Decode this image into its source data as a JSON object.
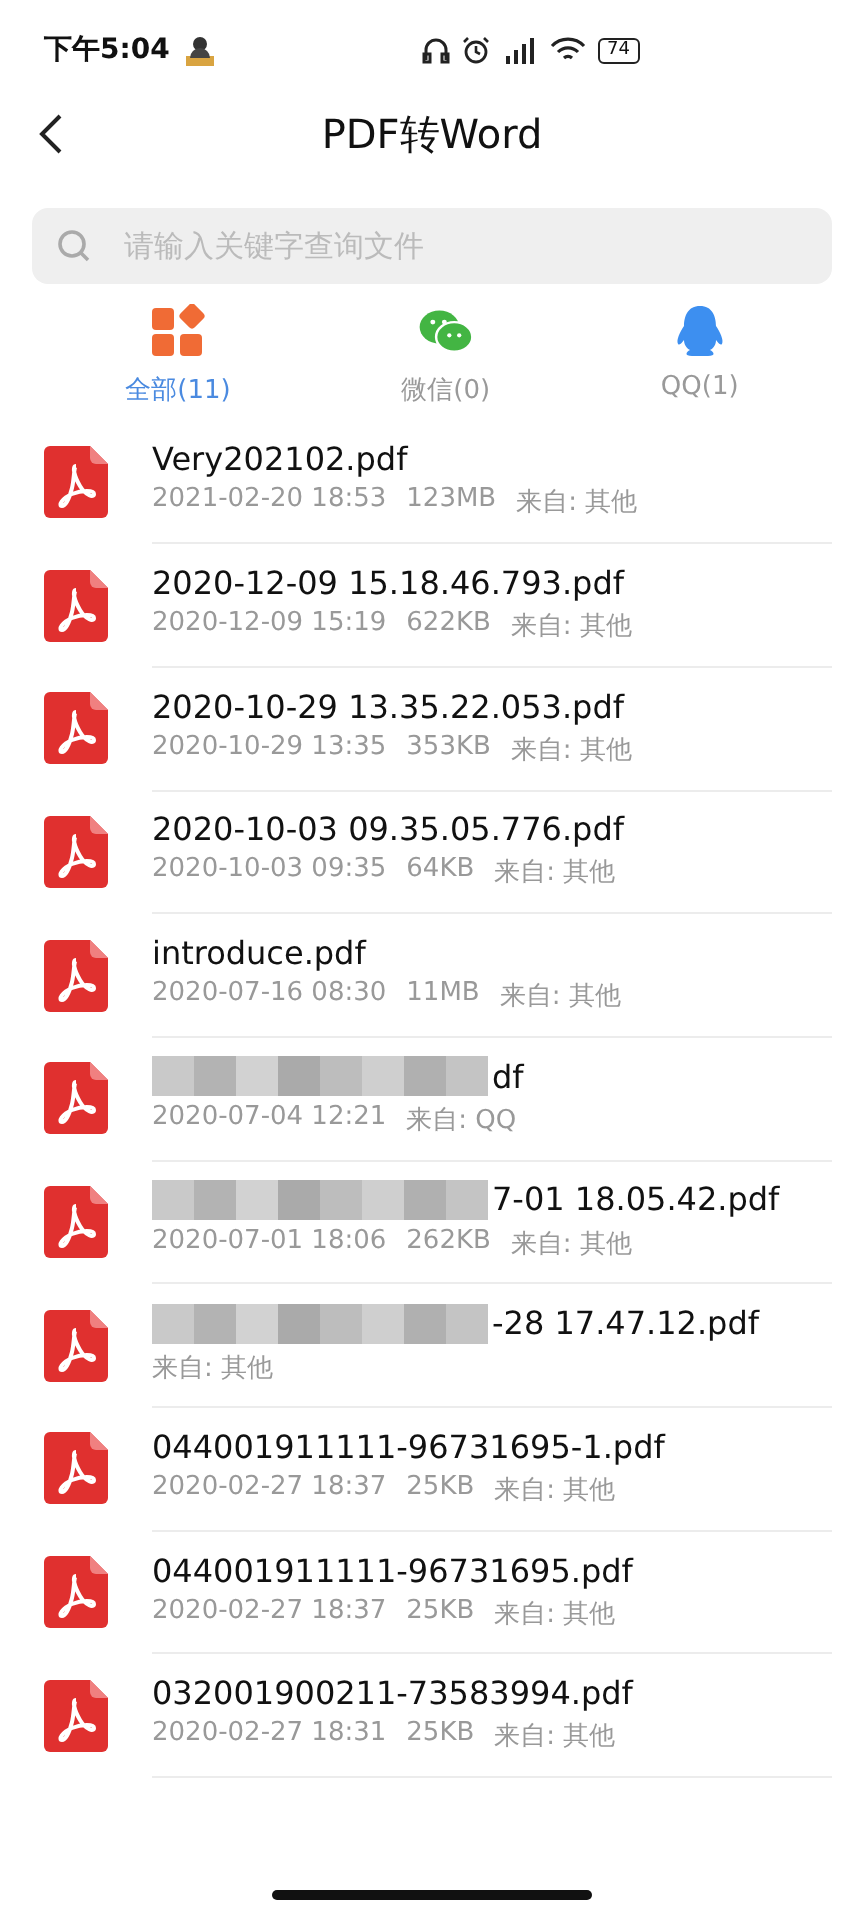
{
  "status_bar": {
    "time": "下午5:04",
    "battery": "74"
  },
  "header": {
    "title": "PDF转Word"
  },
  "search": {
    "placeholder": "请输入关键字查询文件"
  },
  "tabs": [
    {
      "kind": "all",
      "label": "全部(11)",
      "selected": true
    },
    {
      "kind": "wechat",
      "label": "微信(0)",
      "selected": false
    },
    {
      "kind": "qq",
      "label": "QQ(1)",
      "selected": false
    }
  ],
  "files": [
    {
      "name": "Very202102.pdf",
      "date": "2021-02-20 18:53",
      "size": "123MB",
      "source": "来自: 其他",
      "redacted": false
    },
    {
      "name": "2020-12-09 15.18.46.793.pdf",
      "date": "2020-12-09 15:19",
      "size": "622KB",
      "source": "来自: 其他",
      "redacted": false
    },
    {
      "name": "2020-10-29 13.35.22.053.pdf",
      "date": "2020-10-29 13:35",
      "size": "353KB",
      "source": "来自: 其他",
      "redacted": false
    },
    {
      "name": "2020-10-03 09.35.05.776.pdf",
      "date": "2020-10-03 09:35",
      "size": "64KB",
      "source": "来自: 其他",
      "redacted": false
    },
    {
      "name": "introduce.pdf",
      "date": "2020-07-16 08:30",
      "size": "11MB",
      "source": "来自: 其他",
      "redacted": false
    },
    {
      "name": "df",
      "date": "2020-07-04 12:21",
      "source": "来自: QQ",
      "redacted": true
    },
    {
      "name": "7-01 18.05.42.pdf",
      "date": "2020-07-01 18:06",
      "size": "262KB",
      "source": "来自: 其他",
      "redacted": true
    },
    {
      "name": "-28 17.47.12.pdf",
      "source": "来自: 其他",
      "redacted": true
    },
    {
      "name": "044001911111-96731695-1.pdf",
      "date": "2020-02-27 18:37",
      "size": "25KB",
      "source": "来自: 其他",
      "redacted": false
    },
    {
      "name": "044001911111-96731695.pdf",
      "date": "2020-02-27 18:37",
      "size": "25KB",
      "source": "来自: 其他",
      "redacted": false
    },
    {
      "name": "032001900211-73583994.pdf",
      "date": "2020-02-27 18:31",
      "size": "25KB",
      "source": "来自: 其他",
      "redacted": false
    }
  ]
}
